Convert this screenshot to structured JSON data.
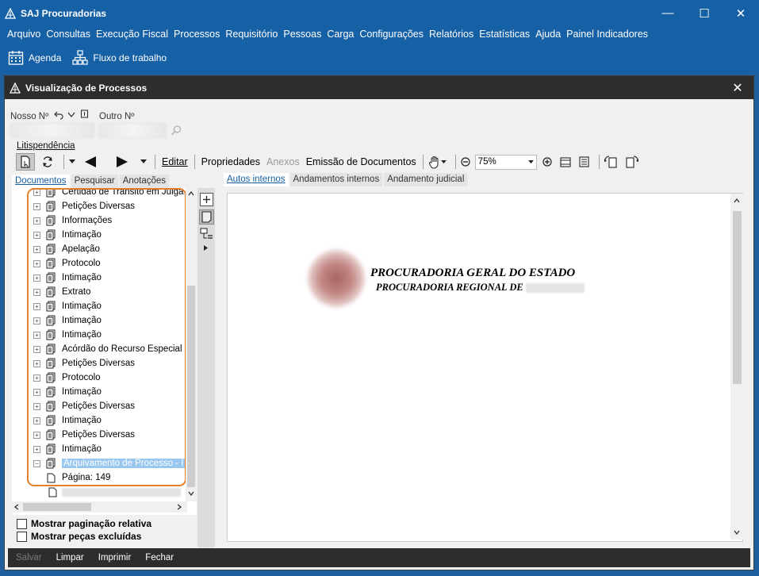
{
  "app": {
    "title": "SAJ Procuradorias"
  },
  "window_controls": {
    "minimize": "—",
    "maximize": "☐",
    "close": "✕"
  },
  "menu": [
    "Arquivo",
    "Consultas",
    "Execução Fiscal",
    "Processos",
    "Requisitório",
    "Pessoas",
    "Carga",
    "Configurações",
    "Relatórios",
    "Estatísticas",
    "Ajuda",
    "Painel Indicadores"
  ],
  "quickbar": {
    "agenda": "Agenda",
    "workflow": "Fluxo de trabalho"
  },
  "child": {
    "title": "Visualização de Processos",
    "close": "✕",
    "nosso_label": "Nosso Nº",
    "outro_label": "Outro Nº",
    "litispendencia": "Litispendência"
  },
  "toolbar": {
    "editar": "Editar",
    "propriedades": "Propriedades",
    "anexos": "Anexos",
    "emissao": "Emissão de Documentos",
    "zoom": "75%"
  },
  "left_tabs": [
    "Documentos",
    "Pesquisar",
    "Anotações"
  ],
  "right_tabs": [
    "Autos internos",
    "Andamentos internos",
    "Andamento judicial"
  ],
  "tree": {
    "items": [
      "Certidão de Trânsito em Julga",
      "Petições Diversas",
      "Informações",
      "Intimação",
      "Apelação",
      "Protocolo",
      "Intimação",
      "Extrato",
      "Intimação",
      "Intimação",
      "Intimação",
      "Acórdão do Recurso Especial",
      "Petições Diversas",
      "Protocolo",
      "Intimação",
      "Petições Diversas",
      "Intimação",
      "Petições Diversas",
      "Intimação",
      "Arquivamento de Processo - I"
    ],
    "page_item": "Página: 149"
  },
  "checkboxes": {
    "relativa": "Mostrar paginação relativa",
    "excluidas": "Mostrar peças excluídas"
  },
  "document": {
    "heading1": "PROCURADORIA GERAL DO ESTADO",
    "heading2": "PROCURADORIA REGIONAL DE"
  },
  "footer": {
    "salvar": "Salvar",
    "limpar": "Limpar",
    "imprimir": "Imprimir",
    "fechar": "Fechar"
  },
  "colors": {
    "title_blue": "#1660a6",
    "dark_bar": "#2d2d2d",
    "highlight": "#e47f2a",
    "selection": "#9ac7ef"
  }
}
